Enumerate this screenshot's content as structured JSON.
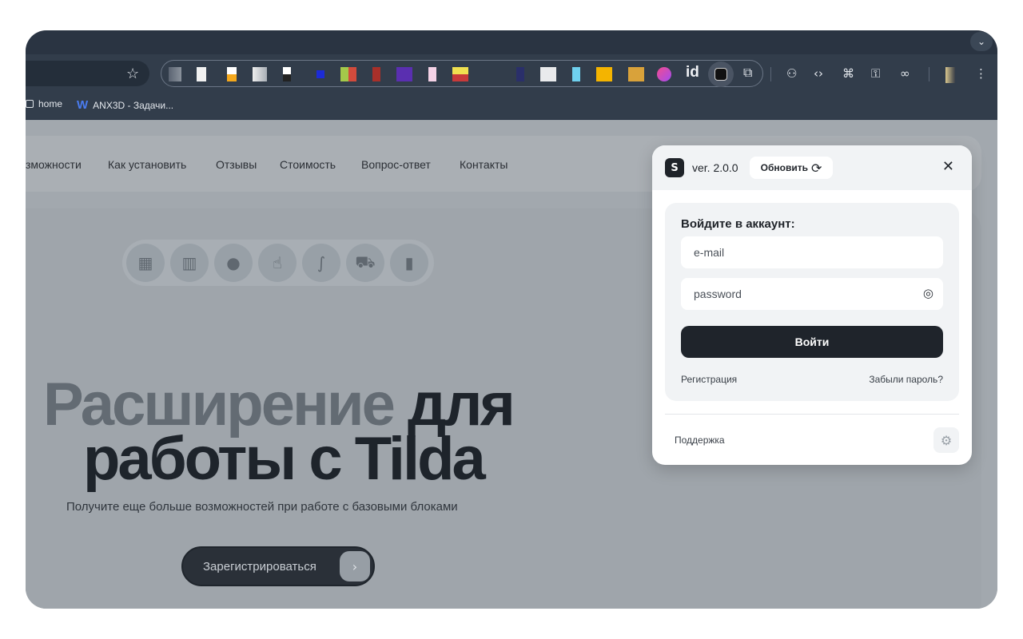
{
  "browser": {
    "bookmarks": [
      {
        "label": "home",
        "icon": "folder-icon"
      },
      {
        "label": "ANX3D - Задачи...",
        "icon": "w-logo-icon"
      }
    ],
    "toolbar_icons": [
      "star-icon",
      "extensions-puzzle-icon",
      "incognito-icon",
      "code-icon",
      "translate-icon",
      "key-icon",
      "link-icon",
      "profile-icon",
      "more-icon"
    ],
    "extension_id_label": "id"
  },
  "site": {
    "nav": [
      "зможности",
      "Как установить",
      "Отзывы",
      "Стоимость",
      "Вопрос-ответ",
      "Контакты"
    ],
    "hero_title_part1": "Расширение",
    "hero_title_part2": "для",
    "hero_title_line2": "работы с Tilda",
    "hero_subtitle": "Получите еще больше возможностей при работе с базовыми блоками",
    "cta_label": "Зарегистрироваться"
  },
  "popup": {
    "version": "ver. 2.0.0",
    "update_label": "Обновить",
    "login_title": "Войдите в аккаунт:",
    "email_placeholder": "e-mail",
    "password_placeholder": "password",
    "submit_label": "Войти",
    "register_link": "Регистрация",
    "forgot_link": "Забыли пароль?",
    "support_link": "Поддержка"
  },
  "colors": {
    "chrome_dark": "#323d4b",
    "popup_button": "#1f242b",
    "page_overlay": "#a2a8ae"
  }
}
